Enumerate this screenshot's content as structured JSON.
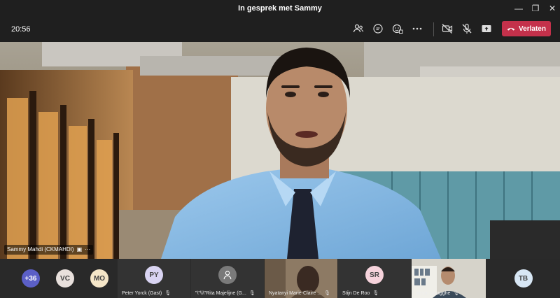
{
  "window": {
    "title": "In gesprek met Sammy"
  },
  "toolbar": {
    "timer": "20:56",
    "leave_label": "Verlaten",
    "leave_color": "#c4314b",
    "icons": [
      "participants-icon",
      "chat-icon",
      "reactions-icon",
      "more-icon",
      "camera-off-icon",
      "mic-off-icon",
      "share-icon",
      "phone-hangup-icon"
    ]
  },
  "main_video": {
    "participant_label": "Sammy Mahdi (CKMAHDI)"
  },
  "strip": {
    "overflow_count": "+36",
    "avatars": [
      {
        "initials": "VC",
        "color": "#e8e0dc",
        "text_color": "#444"
      },
      {
        "initials": "MO",
        "color": "#f5e6c8",
        "text_color": "#444"
      }
    ],
    "tiles": [
      {
        "initials": "PY",
        "name": "Peter Yorck (Gast)",
        "color": "#d9d4f2",
        "text_color": "#444"
      },
      {
        "initials": "",
        "name": "\"\\\"\\\\\\\"Rita Majelijne (G...",
        "color": "#7a7a7a",
        "text_color": "#fff"
      },
      {
        "initials": "",
        "name": "Nyatanyi Marie-Claire ...",
        "color": "",
        "text_color": "#fff"
      },
      {
        "initials": "SR",
        "name": "Stijn De Roo",
        "color": "#f6d3dc",
        "text_color": "#444"
      },
      {
        "initials": "",
        "name": "simon smagghe",
        "color": "",
        "text_color": "#fff"
      },
      {
        "initials": "TB",
        "name": "",
        "color": "#d7e6f4",
        "text_color": "#444"
      }
    ]
  }
}
